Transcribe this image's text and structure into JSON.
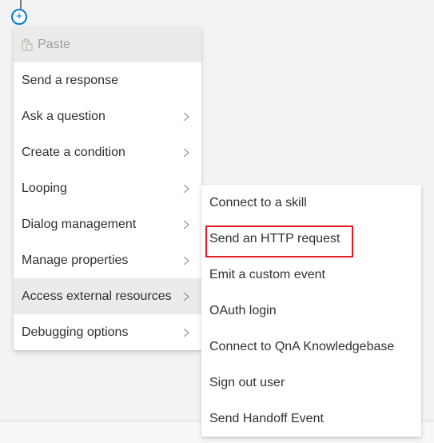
{
  "canvas": {
    "add_node_icon": "plus-icon",
    "add_node_symbol": "+"
  },
  "main_menu": {
    "items": [
      {
        "label": "Paste",
        "icon": "paste-icon",
        "disabled": true
      },
      {
        "label": "Send a response",
        "submenu": false
      },
      {
        "label": "Ask a question",
        "submenu": true
      },
      {
        "label": "Create a condition",
        "submenu": true
      },
      {
        "label": "Looping",
        "submenu": true
      },
      {
        "label": "Dialog management",
        "submenu": true
      },
      {
        "label": "Manage properties",
        "submenu": true
      },
      {
        "label": "Access external resources",
        "submenu": true,
        "active": true
      },
      {
        "label": "Debugging options",
        "submenu": true
      }
    ]
  },
  "sub_menu": {
    "parent": "Access external resources",
    "items": [
      {
        "label": "Connect to a skill"
      },
      {
        "label": "Send an HTTP request",
        "highlighted": true
      },
      {
        "label": "Emit a custom event"
      },
      {
        "label": "OAuth login"
      },
      {
        "label": "Connect to QnA Knowledgebase"
      },
      {
        "label": "Sign out user"
      },
      {
        "label": "Send Handoff Event"
      }
    ]
  },
  "colors": {
    "accent": "#0078d4",
    "highlight_border": "#e11b22",
    "hover_background": "#edebe9"
  }
}
